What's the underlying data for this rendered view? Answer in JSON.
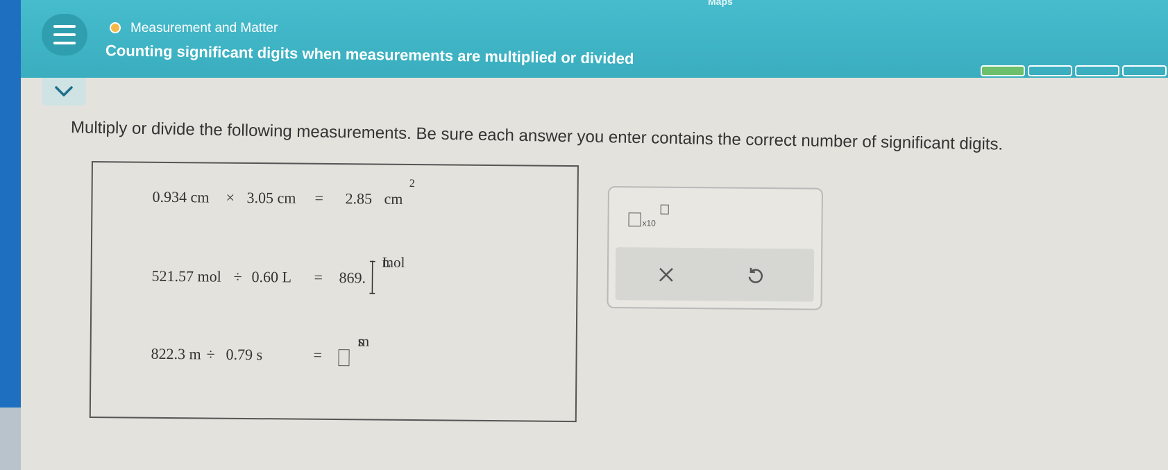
{
  "colors": {
    "header": "#3fb6c8",
    "progress_done": "#6cc06c",
    "topic_dot": "#f4b949"
  },
  "topbar": {
    "fragment": "Maps"
  },
  "header": {
    "topic": "Measurement and Matter",
    "lesson_title": "Counting significant digits when measurements are multiplied or divided",
    "progress": {
      "segments_total": 4,
      "segments_done": 1
    }
  },
  "instructions": "Multiply or divide the following measurements. Be sure each answer you enter contains the correct number of significant digits.",
  "problems": [
    {
      "a": "0.934 cm",
      "op": "×",
      "b": "3.05 cm",
      "eq": "=",
      "answer": "2.85",
      "unit": "cm",
      "unit_exp": "2"
    },
    {
      "a": "521.57 mol",
      "op": "÷",
      "b": "0.60 L",
      "eq": "=",
      "answer": "869.",
      "unit_num": "mol",
      "unit_den": "L"
    },
    {
      "a": "822.3 m",
      "op": "÷",
      "b": "0.79 s",
      "eq": "=",
      "answer": "",
      "unit_num": "m",
      "unit_den": "s"
    }
  ],
  "tools": {
    "sci_notation_label": "x10",
    "clear_icon": "close-icon",
    "undo_icon": "undo-icon"
  }
}
